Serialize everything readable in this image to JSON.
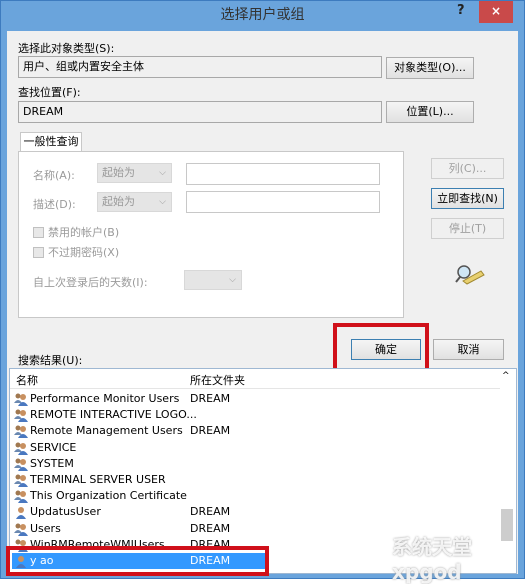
{
  "window": {
    "title": "选择用户或组",
    "help": "?",
    "close": "×"
  },
  "object_type": {
    "label": "选择此对象类型(S):",
    "value": "用户、组或内置安全主体",
    "button": "对象类型(O)..."
  },
  "location": {
    "label": "查找位置(F):",
    "value": "DREAM",
    "button": "位置(L)..."
  },
  "query": {
    "tab": "一般性查询",
    "name_label": "名称(A):",
    "name_mode": "起始为",
    "name_value": "",
    "desc_label": "描述(D):",
    "desc_mode": "起始为",
    "desc_value": "",
    "disabled_accounts": "禁用的帐户(B)",
    "disabled_checked": false,
    "non_expiring": "不过期密码(X)",
    "non_expiring_checked": false,
    "days_label": "自上次登录后的天数(I):",
    "days_value": ""
  },
  "side_buttons": {
    "columns": "列(C)...",
    "find_now": "立即查找(N)",
    "stop": "停止(T)"
  },
  "ok": "确定",
  "cancel": "取消",
  "results": {
    "label": "搜索结果(U):",
    "columns": [
      "名称",
      "所在文件夹"
    ],
    "rows": [
      {
        "name": "Performance Monitor Users",
        "folder": "DREAM",
        "icon": "group-icon"
      },
      {
        "name": "REMOTE INTERACTIVE LOGO...",
        "folder": "",
        "icon": "group-icon"
      },
      {
        "name": "Remote Management Users",
        "folder": "DREAM",
        "icon": "group-icon"
      },
      {
        "name": "SERVICE",
        "folder": "",
        "icon": "group-icon"
      },
      {
        "name": "SYSTEM",
        "folder": "",
        "icon": "group-icon"
      },
      {
        "name": "TERMINAL SERVER USER",
        "folder": "",
        "icon": "group-icon"
      },
      {
        "name": "This Organization Certificate",
        "folder": "",
        "icon": "group-icon"
      },
      {
        "name": "UpdatusUser",
        "folder": "DREAM",
        "icon": "user-icon"
      },
      {
        "name": "Users",
        "folder": "DREAM",
        "icon": "group-icon"
      },
      {
        "name": "WinRMRemoteWMIUsers",
        "folder": "DREAM",
        "icon": "group-icon"
      },
      {
        "name": "y        ao",
        "folder": "DREAM",
        "icon": "user-icon",
        "selected": true
      }
    ]
  },
  "highlight_color": "#d0101a",
  "watermark": "系统天堂 xpgod .com"
}
